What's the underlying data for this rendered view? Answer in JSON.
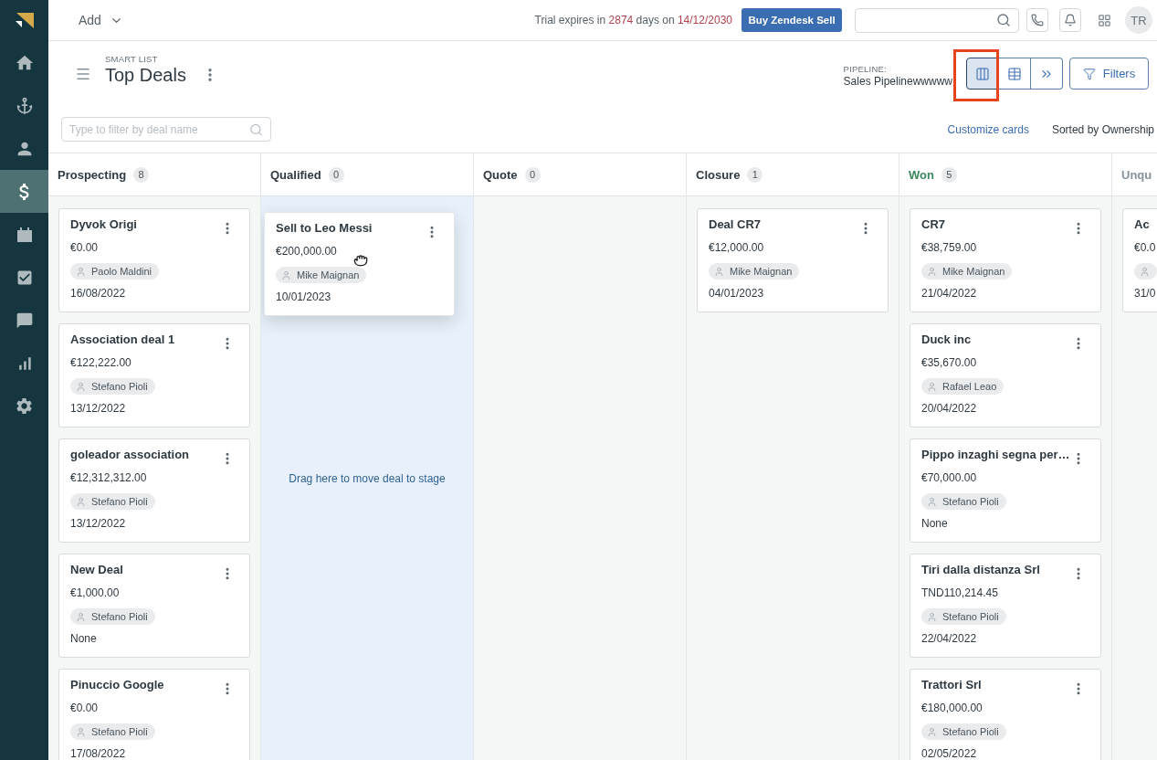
{
  "sidebar": {
    "items": [
      {
        "selected": false
      },
      {
        "selected": false
      },
      {
        "selected": false
      },
      {
        "selected": true
      },
      {
        "selected": false
      },
      {
        "selected": false
      },
      {
        "selected": false
      },
      {
        "selected": false
      },
      {
        "selected": false
      }
    ]
  },
  "top_bar": {
    "add_menu": "Add",
    "trial_notice": [
      {
        "text": "Trial expires in ",
        "highlight": false
      },
      {
        "text": "2874",
        "highlight": true
      },
      {
        "text": " days on ",
        "highlight": false
      },
      {
        "text": "14/12/2030",
        "highlight": true
      }
    ],
    "buy_button": "Buy Zendesk Sell",
    "avatar": "TR"
  },
  "header": {
    "eyebrow": "SMART LIST",
    "title": "Top Deals",
    "pipeline": {
      "label": "PIPELINE:",
      "value": "Sales Pipelinewwwww"
    },
    "view_options": [
      {
        "selected": true,
        "annotated": true
      },
      {
        "selected": false,
        "annotated": false
      },
      {
        "selected": false,
        "annotated": false
      }
    ],
    "filters_button": "Filters",
    "filter_field": {
      "placeholder": "Type to filter by deal name"
    },
    "customize_link": "Customize cards",
    "sort_label": "Sorted by Ownership"
  },
  "board": {
    "columns": [
      {
        "title": "Prospecting",
        "count": "8",
        "color": "#2f3941",
        "drop_target": false,
        "cards": [
          {
            "title": "Dyvok Origi",
            "amount": "€0.00",
            "owner": "Paolo Maldini",
            "date": "16/08/2022"
          },
          {
            "title": "Association deal 1",
            "amount": "€122,222.00",
            "owner": "Stefano Pioli",
            "date": "13/12/2022"
          },
          {
            "title": "goleador association",
            "amount": "€12,312,312.00",
            "owner": "Stefano Pioli",
            "date": "13/12/2022"
          },
          {
            "title": "New Deal",
            "amount": "€1,000.00",
            "owner": "Stefano Pioli",
            "date": "None"
          },
          {
            "title": "Pinuccio Google",
            "amount": "€0.00",
            "owner": "Stefano Pioli",
            "date": "17/08/2022"
          }
        ]
      },
      {
        "title": "Qualified",
        "count": "0",
        "color": "#2f3941",
        "drop_target": true,
        "drop_hint": "Drag here to move deal to stage"
      },
      {
        "title": "Quote",
        "count": "0",
        "color": "#2f3941",
        "drop_target": false
      },
      {
        "title": "Closure",
        "count": "1",
        "color": "#2f3941",
        "drop_target": false,
        "cards": [
          {
            "title": "Deal CR7",
            "amount": "€12,000.00",
            "owner": "Mike Maignan",
            "date": "04/01/2023"
          }
        ]
      },
      {
        "title": "Won",
        "count": "5",
        "color": "#3a8a5e",
        "drop_target": false,
        "cards": [
          {
            "title": "CR7",
            "amount": "€38,759.00",
            "owner": "Mike Maignan",
            "date": "21/04/2022"
          },
          {
            "title": "Duck inc",
            "amount": "€35,670.00",
            "owner": "Rafael Leao",
            "date": "20/04/2022"
          },
          {
            "title": "Pippo inzaghi segna per…",
            "amount": "€70,000.00",
            "owner": "Stefano Pioli",
            "date": "None"
          },
          {
            "title": "Tiri dalla distanza Srl",
            "amount": "TND110,214.45",
            "owner": "Stefano Pioli",
            "date": "22/04/2022"
          },
          {
            "title": "Trattori Srl",
            "amount": "€180,000.00",
            "owner": "Stefano Pioli",
            "date": "02/05/2022"
          }
        ]
      },
      {
        "title": "Unqu",
        "color": "#87929d",
        "drop_target": false,
        "cards": [
          {
            "title": "Ac",
            "amount": "€0.0",
            "date": "31/0"
          }
        ]
      }
    ],
    "dragged_card": {
      "title": "Sell to Leo Messi",
      "amount": "€200,000.00",
      "owner": "Mike Maignan",
      "date": "10/01/2023"
    }
  }
}
